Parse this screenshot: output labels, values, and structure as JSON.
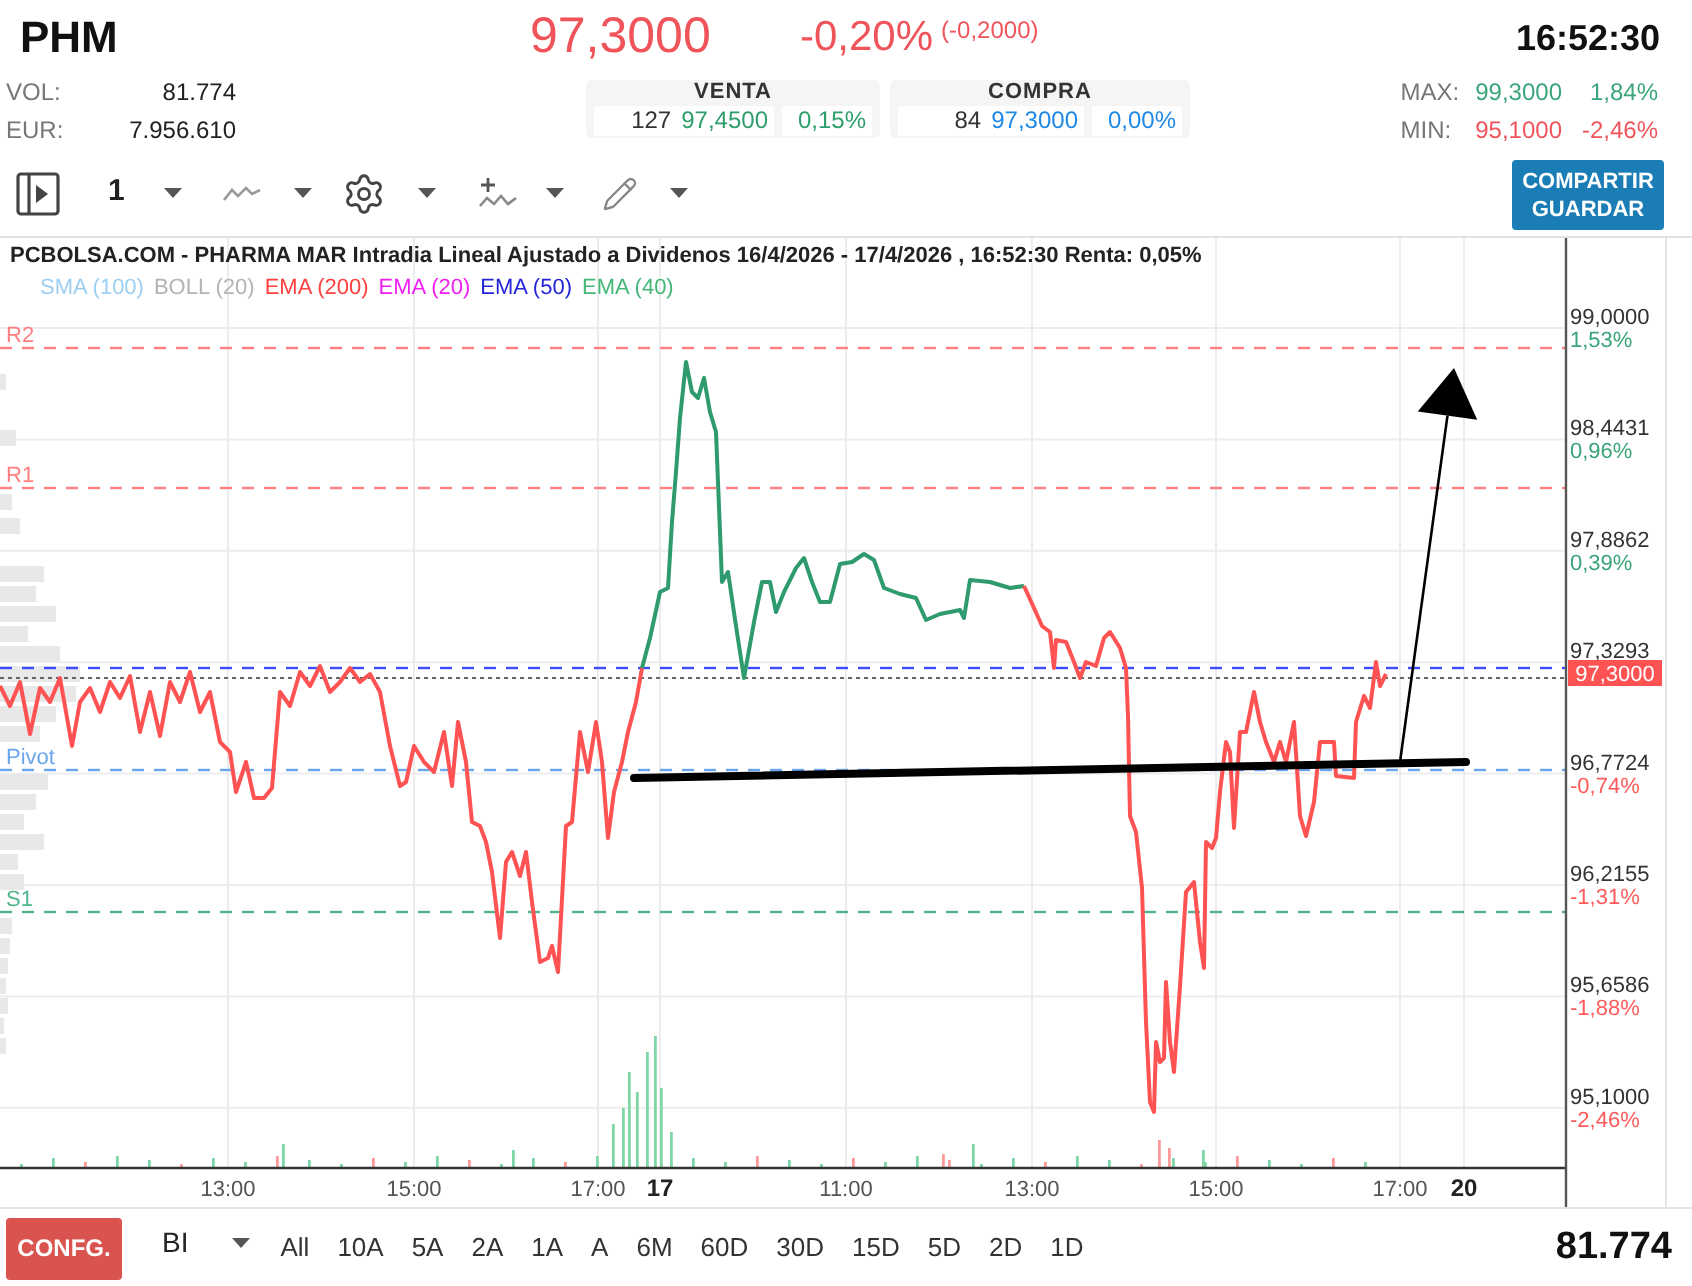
{
  "quote": {
    "symbol": "PHM",
    "price": "97,3000",
    "change_percent": "-0,20%",
    "change": "(-0,2000)",
    "time": "16:52:30"
  },
  "totals": [
    {
      "label": "VOL:",
      "value": "81.774"
    },
    {
      "label": "EUR:",
      "value": "7.956.610"
    }
  ],
  "order_book": [
    {
      "kind": "sell",
      "title": "VENTA",
      "quantity": "127",
      "price": "97,4500",
      "percent": "0,15%"
    },
    {
      "kind": "buy",
      "title": "COMPRA",
      "quantity": "84",
      "price": "97,3000",
      "percent": "0,00%"
    }
  ],
  "range_stats": [
    {
      "kind": "max",
      "label": "MAX:",
      "price": "99,3000",
      "percent": "1,84%"
    },
    {
      "kind": "min",
      "label": "MIN:",
      "price": "95,1000",
      "percent": "-2,46%"
    }
  ],
  "toolbar": [
    {
      "kind": "panel"
    },
    {
      "kind": "count",
      "label": "1"
    },
    {
      "kind": "chart_type"
    },
    {
      "kind": "settings"
    },
    {
      "kind": "indicators"
    },
    {
      "kind": "drawing"
    }
  ],
  "share_button": {
    "lines": [
      "COMPARTIR",
      "GUARDAR"
    ]
  },
  "chart": {
    "title": "PCBOLSA.COM - PHARMA MAR Intradia Lineal Ajustado a Dividenos 16/4/2026 - 17/4/2026 , 16:52:30 Renta: 0,05%",
    "legend": [
      {
        "label": "SMA (100)",
        "color": "#9ccff2"
      },
      {
        "label": "BOLL (20)",
        "color": "#b4b4b4"
      },
      {
        "label": "EMA (200)",
        "color": "#ff4040"
      },
      {
        "label": "EMA (20)",
        "color": "#f020f0"
      },
      {
        "label": "EMA (50)",
        "color": "#2424d8"
      },
      {
        "label": "EMA (40)",
        "color": "#45b878"
      }
    ],
    "levels": [
      {
        "label": "R2",
        "color": "#ff8080"
      },
      {
        "label": "R1",
        "color": "#ff8080"
      },
      {
        "color": "#3b4bff"
      },
      {
        "label": "Pivot",
        "color": "#6aa6ee"
      },
      {
        "label": "S1",
        "color": "#4fb48a"
      }
    ],
    "price_axis": [
      {
        "price": "99,0000",
        "change": "1,53%",
        "up": true
      },
      {
        "price": "98,4431",
        "change": "0,96%",
        "up": true
      },
      {
        "price": "97,8862",
        "change": "0,39%",
        "up": true
      },
      {
        "price": "97,3293"
      },
      {
        "price": "96,7724",
        "change": "-0,74%",
        "up": false
      },
      {
        "price": "96,2155",
        "change": "-1,31%",
        "up": false
      },
      {
        "price": "95,6586",
        "change": "-1,88%",
        "up": false
      },
      {
        "price": "95,1000",
        "change": "-2,46%",
        "up": false
      }
    ],
    "price_tag": "97,3000",
    "time_axis": [
      {
        "label": "13:00",
        "day": false
      },
      {
        "label": "15:00",
        "day": false
      },
      {
        "label": "17:00",
        "day": false
      },
      {
        "label": "17",
        "day": true
      },
      {
        "label": "11:00",
        "day": false
      },
      {
        "label": "13:00",
        "day": false
      },
      {
        "label": "15:00",
        "day": false
      },
      {
        "label": "17:00",
        "day": false
      },
      {
        "label": "20",
        "day": true
      }
    ]
  },
  "bottom_bar": {
    "config_button": "CONFG.",
    "interval": "BI",
    "ranges": [
      {
        "label": "All",
        "selected": false
      },
      {
        "label": "10A",
        "selected": false
      },
      {
        "label": "5A",
        "selected": false
      },
      {
        "label": "2A",
        "selected": false
      },
      {
        "label": "1A",
        "selected": false
      },
      {
        "label": "A",
        "selected": false
      },
      {
        "label": "6M",
        "selected": false
      },
      {
        "label": "60D",
        "selected": false
      },
      {
        "label": "30D",
        "selected": false
      },
      {
        "label": "15D",
        "selected": false
      },
      {
        "label": "5D",
        "selected": false
      },
      {
        "label": "2D",
        "selected": false
      },
      {
        "label": "1D",
        "selected": false
      }
    ],
    "volume": "81.774"
  }
}
